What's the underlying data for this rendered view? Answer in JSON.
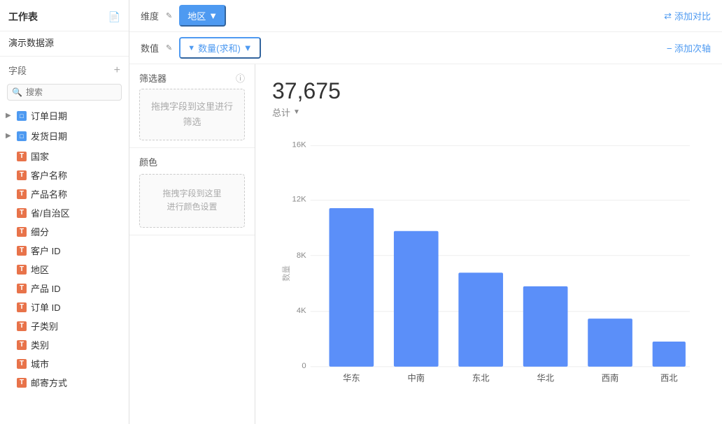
{
  "sidebar": {
    "title": "工作表",
    "datasource": "演示数据源",
    "fields_label": "字段",
    "search_placeholder": "搜索",
    "field_groups": [
      {
        "name": "订单日期",
        "type": "date",
        "expanded": false
      },
      {
        "name": "发货日期",
        "type": "date",
        "expanded": false
      }
    ],
    "fields": [
      {
        "name": "国家",
        "type": "T"
      },
      {
        "name": "客户名称",
        "type": "T"
      },
      {
        "name": "产品名称",
        "type": "T"
      },
      {
        "name": "省/自治区",
        "type": "T"
      },
      {
        "name": "细分",
        "type": "T"
      },
      {
        "name": "客户 ID",
        "type": "T"
      },
      {
        "name": "地区",
        "type": "T"
      },
      {
        "name": "产品 ID",
        "type": "T"
      },
      {
        "name": "订单 ID",
        "type": "T"
      },
      {
        "name": "子类别",
        "type": "T"
      },
      {
        "name": "类别",
        "type": "T"
      },
      {
        "name": "城市",
        "type": "T"
      },
      {
        "name": "邮寄方式",
        "type": "T"
      }
    ]
  },
  "toolbar": {
    "dimension_label": "维度",
    "dimension_edit_icon": "✎",
    "dimension_btn": "地区",
    "add_compare_label": "添加对比",
    "value_label": "数值",
    "value_btn": "数量(求和)",
    "add_secondary_axis_label": "添加次轴",
    "filter_label": "筛选器",
    "filter_drop_hint": "拖拽字段到这里进行筛选",
    "info_icon": "ⓘ",
    "color_label": "颜色",
    "color_drop_hint_line1": "拖拽字段到这里",
    "color_drop_hint_line2": "进行颜色设置"
  },
  "chart": {
    "total_value": "37,675",
    "total_label": "总计",
    "y_labels": [
      "16K",
      "12K",
      "8K",
      "4K",
      "0"
    ],
    "y_axis_label": "数量",
    "bars": [
      {
        "label": "华东",
        "value": 11500,
        "height_pct": 0.72
      },
      {
        "label": "中南",
        "value": 9800,
        "height_pct": 0.61
      },
      {
        "label": "东北",
        "value": 6800,
        "height_pct": 0.425
      },
      {
        "label": "华北",
        "value": 5800,
        "height_pct": 0.363
      },
      {
        "label": "西南",
        "value": 3500,
        "height_pct": 0.219
      },
      {
        "label": "西北",
        "value": 1800,
        "height_pct": 0.113
      }
    ],
    "bar_color": "#5b8ff9",
    "max_value": 16000
  }
}
